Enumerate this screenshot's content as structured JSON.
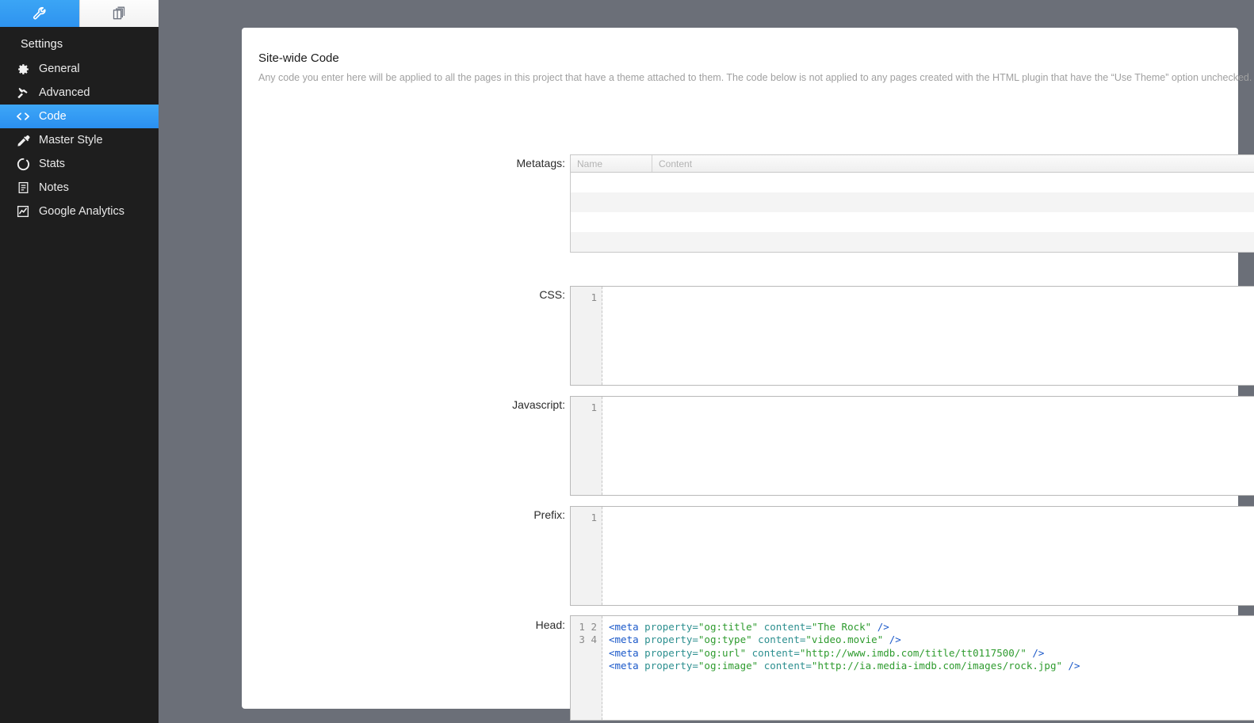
{
  "sidebar": {
    "tabs": [
      {
        "name": "tools-tab",
        "icon": "wrench-icon",
        "active": true
      },
      {
        "name": "pages-tab",
        "icon": "stacked-pages-icon",
        "active": false
      }
    ],
    "title": "Settings",
    "items": [
      {
        "label": "General",
        "icon": "gear-icon",
        "selected": false
      },
      {
        "label": "Advanced",
        "icon": "hammer-icon",
        "selected": false
      },
      {
        "label": "Code",
        "icon": "code-brackets-icon",
        "selected": true
      },
      {
        "label": "Master Style",
        "icon": "eyedropper-icon",
        "selected": false
      },
      {
        "label": "Stats",
        "icon": "stats-arc-icon",
        "selected": false
      },
      {
        "label": "Notes",
        "icon": "notes-document-icon",
        "selected": false
      },
      {
        "label": "Google Analytics",
        "icon": "analytics-chart-icon",
        "selected": false
      }
    ]
  },
  "main": {
    "title": "Site-wide Code",
    "description": "Any code you enter here will be applied to all the pages in this project that have a theme attached to them. The code below is not applied to any pages created with the HTML plugin that have the “Use Theme” option unchecked.",
    "labels": {
      "metatags": "Metatags:",
      "css": "CSS:",
      "javascript": "Javascript:",
      "prefix": "Prefix:",
      "head": "Head:"
    },
    "metatags": {
      "columns": [
        "Name",
        "Content"
      ],
      "rows": [],
      "empty_row_count": 4,
      "remove_label": "–",
      "add_label": "+"
    },
    "editors": {
      "css": {
        "line_numbers": [
          "1"
        ],
        "lines": []
      },
      "javascript": {
        "line_numbers": [
          "1"
        ],
        "lines": []
      },
      "prefix": {
        "line_numbers": [
          "1"
        ],
        "lines": []
      },
      "head": {
        "line_numbers": [
          "1",
          "2",
          "3",
          "4"
        ],
        "lines": [
          "<meta property=\"og:title\" content=\"The Rock\" />",
          "<meta property=\"og:type\" content=\"video.movie\" />",
          "<meta property=\"og:url\" content=\"http://www.imdb.com/title/tt0117500/\" />",
          "<meta property=\"og:image\" content=\"http://ia.media-imdb.com/images/rock.jpg\" />"
        ],
        "tokens": [
          [
            {
              "t": "<meta",
              "c": "tag"
            },
            {
              "t": " ",
              "c": "plain"
            },
            {
              "t": "property=",
              "c": "attr"
            },
            {
              "t": "\"og:title\"",
              "c": "str"
            },
            {
              "t": " ",
              "c": "plain"
            },
            {
              "t": "content=",
              "c": "attr"
            },
            {
              "t": "\"The Rock\"",
              "c": "str"
            },
            {
              "t": " ",
              "c": "plain"
            },
            {
              "t": "/>",
              "c": "punct"
            }
          ],
          [
            {
              "t": "<meta",
              "c": "tag"
            },
            {
              "t": " ",
              "c": "plain"
            },
            {
              "t": "property=",
              "c": "attr"
            },
            {
              "t": "\"og:type\"",
              "c": "str"
            },
            {
              "t": " ",
              "c": "plain"
            },
            {
              "t": "content=",
              "c": "attr"
            },
            {
              "t": "\"video.movie\"",
              "c": "str"
            },
            {
              "t": " ",
              "c": "plain"
            },
            {
              "t": "/>",
              "c": "punct"
            }
          ],
          [
            {
              "t": "<meta",
              "c": "tag"
            },
            {
              "t": " ",
              "c": "plain"
            },
            {
              "t": "property=",
              "c": "attr"
            },
            {
              "t": "\"og:url\"",
              "c": "str"
            },
            {
              "t": " ",
              "c": "plain"
            },
            {
              "t": "content=",
              "c": "attr"
            },
            {
              "t": "\"http://www.imdb.com/title/tt0117500/\"",
              "c": "str"
            },
            {
              "t": " ",
              "c": "plain"
            },
            {
              "t": "/>",
              "c": "punct"
            }
          ],
          [
            {
              "t": "<meta",
              "c": "tag"
            },
            {
              "t": " ",
              "c": "plain"
            },
            {
              "t": "property=",
              "c": "attr"
            },
            {
              "t": "\"og:image\"",
              "c": "str"
            },
            {
              "t": " ",
              "c": "plain"
            },
            {
              "t": "content=",
              "c": "attr"
            },
            {
              "t": "\"http://ia.media-imdb.com/images/rock.jpg\"",
              "c": "str"
            },
            {
              "t": " ",
              "c": "plain"
            },
            {
              "t": "/>",
              "c": "punct"
            }
          ]
        ]
      }
    }
  },
  "colors": {
    "accent": "#2e93ef",
    "sidebar_bg": "#1e1e1e",
    "page_bg": "#6b6f78",
    "panel_bg": "#ffffff",
    "code_tag": "#1a58c9",
    "code_attr": "#2c8f8f",
    "code_string": "#2e9b2e"
  }
}
